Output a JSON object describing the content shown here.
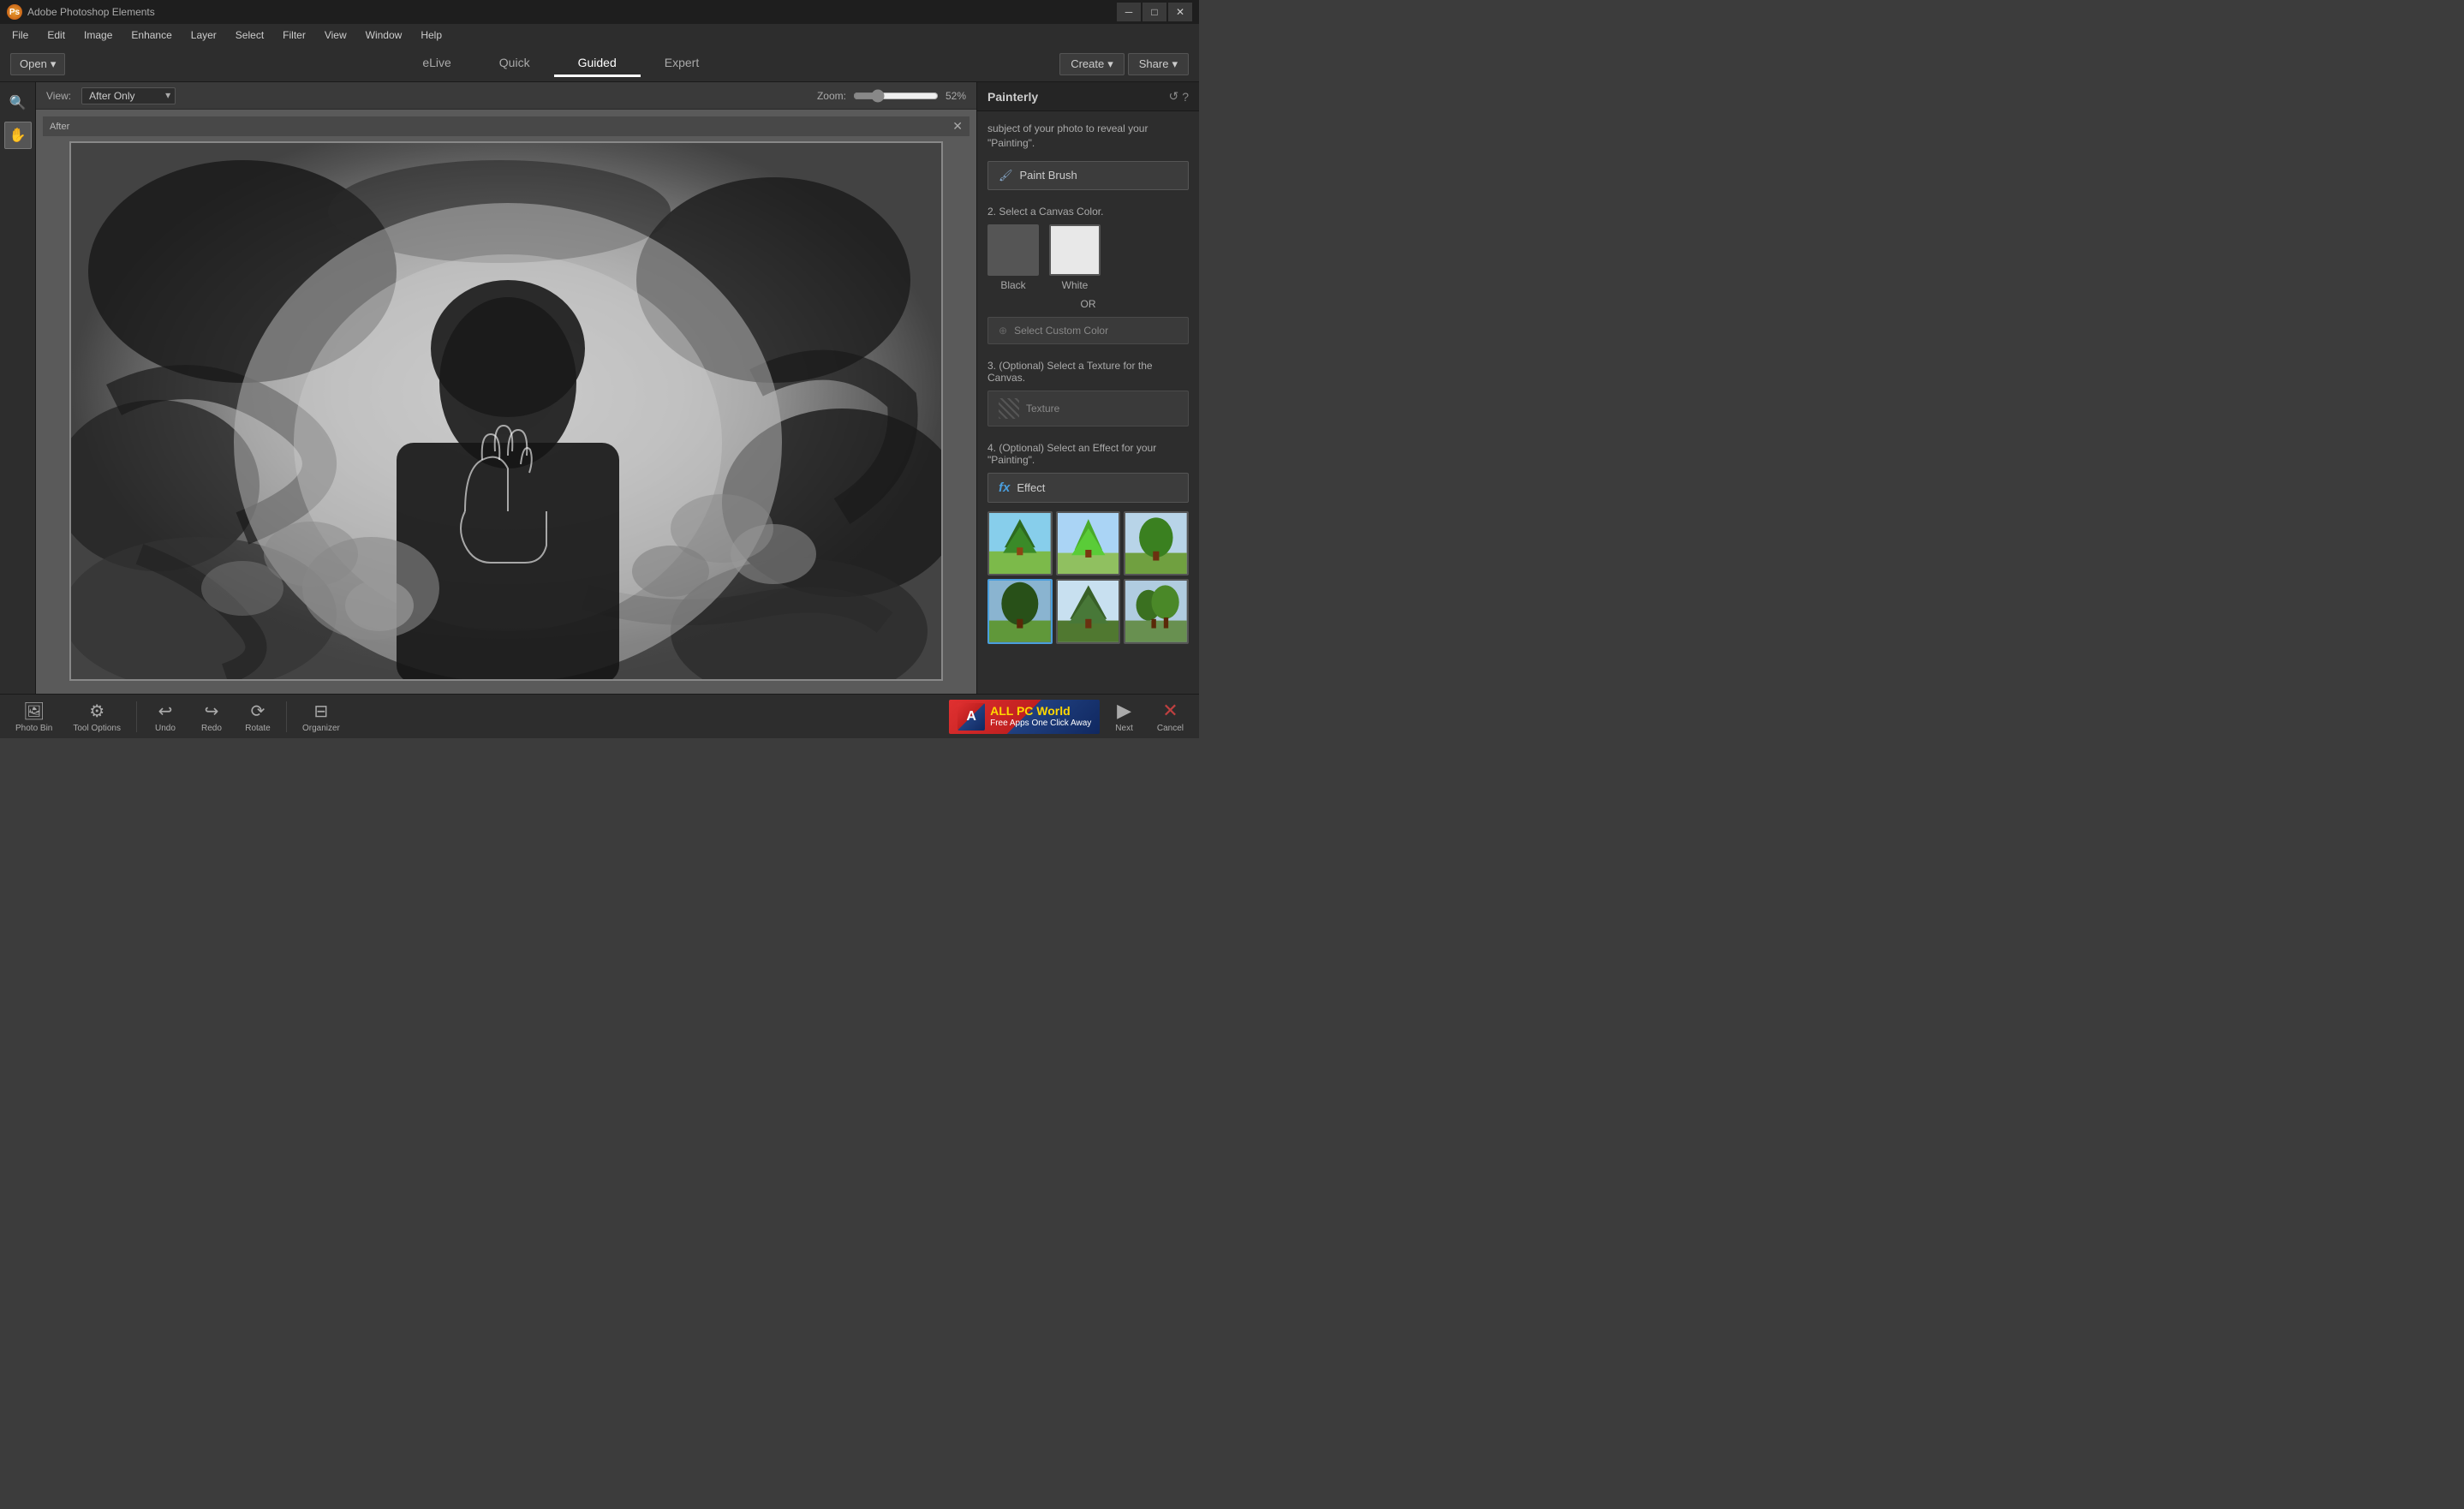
{
  "titlebar": {
    "app_name": "Adobe Photoshop Elements"
  },
  "menubar": {
    "items": [
      "File",
      "Edit",
      "Image",
      "Enhance",
      "Layer",
      "Select",
      "Filter",
      "View",
      "Window",
      "Help"
    ]
  },
  "modebar": {
    "open_label": "Open",
    "tabs": [
      "eLive",
      "Quick",
      "Guided",
      "Expert"
    ],
    "active_tab": "Guided",
    "create_label": "Create",
    "share_label": "Share"
  },
  "view_bar": {
    "view_label": "View:",
    "view_option": "After Only",
    "zoom_label": "Zoom:",
    "zoom_percent": "52%"
  },
  "canvas": {
    "header_label": "After"
  },
  "panel": {
    "title": "Painterly",
    "intro_text": "subject of your photo to reveal your \"Painting\".",
    "step1_label": "Paint Brush",
    "step2_label": "2. Select a Canvas Color.",
    "black_label": "Black",
    "white_label": "White",
    "or_text": "OR",
    "custom_color_label": "Select Custom Color",
    "step3_label": "3. (Optional) Select a Texture for the Canvas.",
    "texture_label": "Texture",
    "step4_label": "4. (Optional) Select an Effect for your \"Painting\".",
    "effect_label": "Effect"
  },
  "bottom_bar": {
    "photo_bin_label": "Photo Bin",
    "tool_options_label": "Tool Options",
    "undo_label": "Undo",
    "redo_label": "Redo",
    "rotate_label": "Rotate",
    "organizer_label": "Organizer",
    "next_label": "Next",
    "cancel_label": "Cancel",
    "allpcworld_line1": "ALL PC World",
    "allpcworld_line2": "Free Apps One Click Away"
  },
  "icons": {
    "search": "🔍",
    "hand": "✋",
    "open_arrow": "▾",
    "refresh": "↺",
    "help": "?",
    "paint_brush": "🖌",
    "eyedropper": "⊕",
    "texture_grid": "⊞",
    "fx": "fx",
    "next_arrow": "▶",
    "cancel_x": "✕",
    "photo_bin": "🖼",
    "tool_options": "⚙",
    "undo_icon": "↩",
    "redo_icon": "↪",
    "rotate_icon": "⟳",
    "organizer_icon": "⊟",
    "minimize": "─",
    "maximize": "□",
    "close": "✕"
  }
}
